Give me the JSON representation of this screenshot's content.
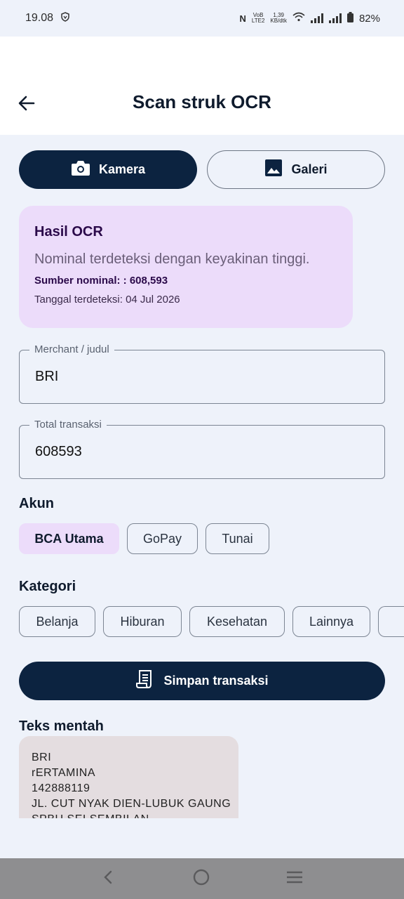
{
  "status_bar": {
    "time": "19.08",
    "network_top": "VoB",
    "network_bottom": "LTE2",
    "speed_top": "1,39",
    "speed_bottom": "KB/dtk",
    "battery": "82%"
  },
  "app_bar": {
    "title": "Scan struk OCR"
  },
  "source_toggle": {
    "camera_label": "Kamera",
    "gallery_label": "Galeri"
  },
  "ocr_result": {
    "title": "Hasil OCR",
    "description": "Nominal terdeteksi dengan keyakinan tinggi.",
    "nominal": "Sumber nominal: : 608,593",
    "date": "Tanggal terdeteksi: 04 Jul 2026"
  },
  "form": {
    "merchant_label": "Merchant / judul",
    "merchant_value": "BRI",
    "total_label": "Total transaksi",
    "total_value": "608593"
  },
  "accounts": {
    "label": "Akun",
    "items": [
      "BCA Utama",
      "GoPay",
      "Tunai"
    ],
    "selected": "BCA Utama"
  },
  "categories": {
    "label": "Kategori",
    "items": [
      "Belanja",
      "Hiburan",
      "Kesehatan",
      "Lainnya"
    ]
  },
  "save_button": {
    "label": "Simpan transaksi"
  },
  "raw_text": {
    "label": "Teks mentah",
    "lines": [
      "BRI",
      "rERTAMINA",
      "142888119",
      "JL. CUT NYAK DIEN-LUBUK GAUNG",
      "SPBU SEI SEMBILAN"
    ]
  },
  "colors": {
    "primary": "#0c2340",
    "ocr_card": "#ecdcfa",
    "background": "#eef2fa"
  }
}
